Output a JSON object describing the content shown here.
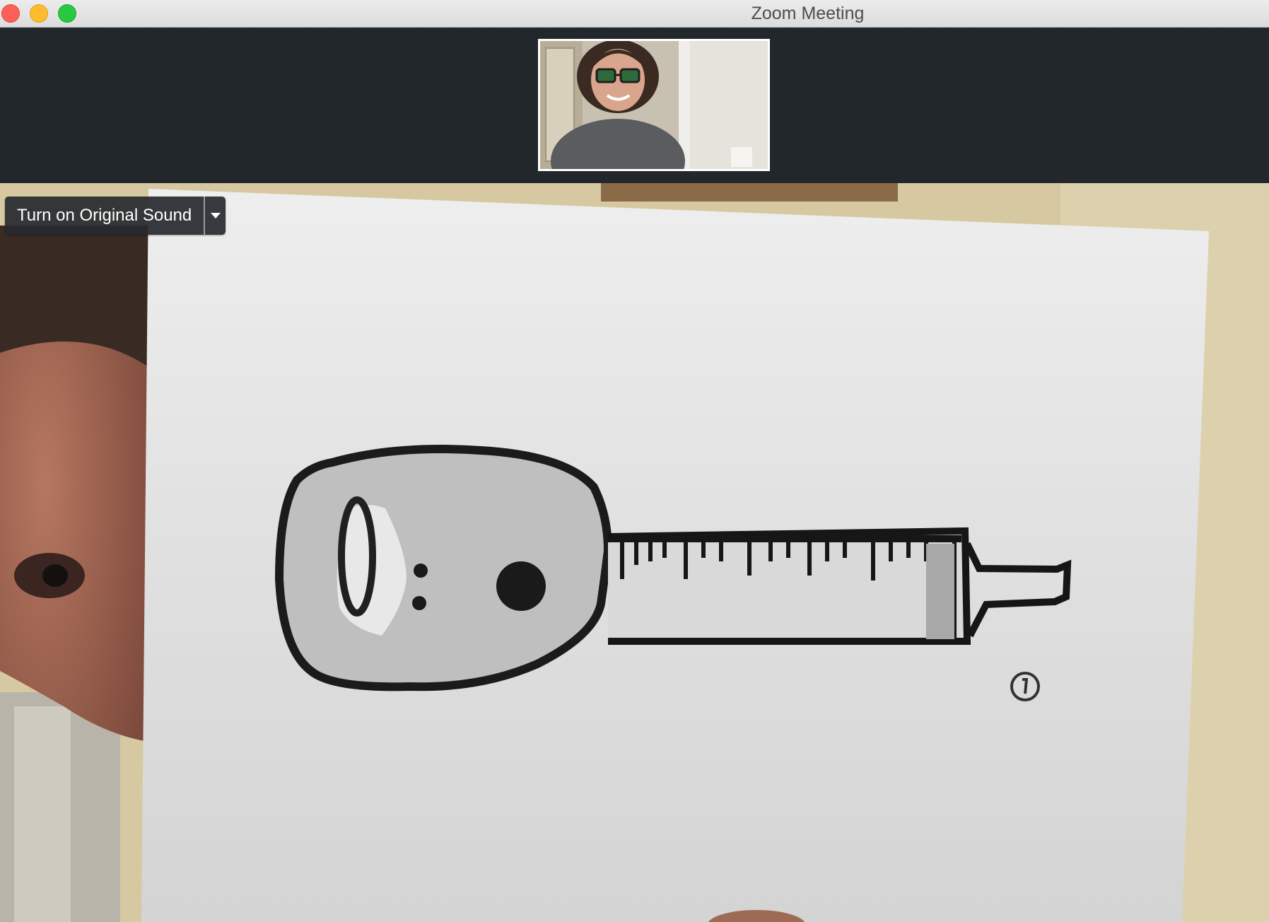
{
  "window": {
    "title": "Zoom Meeting"
  },
  "participants": {
    "thumbnail_icon": "participant-video-thumbnail"
  },
  "main_video": {
    "icon": "shared-drawing-video"
  },
  "audio": {
    "original_sound_label": "Turn on Original Sound",
    "dropdown_icon": "chevron-down-icon"
  },
  "colors": {
    "close": "#fc5f57",
    "minimize": "#fdbc2e",
    "maximize": "#28c840",
    "strip_background": "#22272b"
  }
}
